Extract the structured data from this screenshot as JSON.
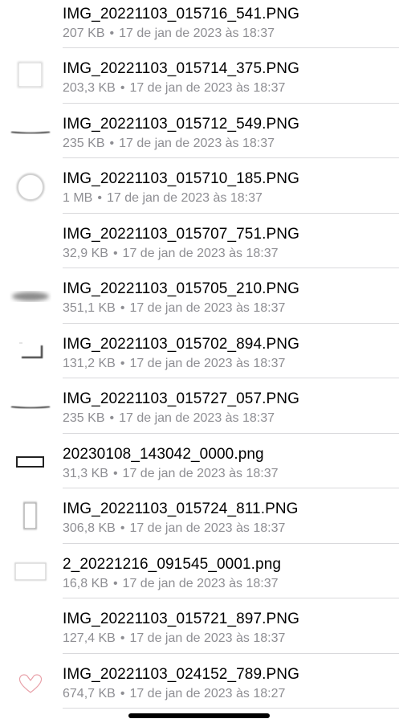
{
  "files": [
    {
      "name": "IMG_20221103_015716_541.PNG",
      "size": "207 KB",
      "date": "17 de jan de 2023 às 18:37",
      "thumbnail": "thin-line-thumbnail"
    },
    {
      "name": "IMG_20221103_015714_375.PNG",
      "size": "203,3 KB",
      "date": "17 de jan de 2023 às 18:37",
      "thumbnail": "square-thumbnail"
    },
    {
      "name": "IMG_20221103_015712_549.PNG",
      "size": "235 KB",
      "date": "17 de jan de 2023 às 18:37",
      "thumbnail": "dark-line-thumbnail"
    },
    {
      "name": "IMG_20221103_015710_185.PNG",
      "size": "1 MB",
      "date": "17 de jan de 2023 às 18:37",
      "thumbnail": "circle-thumbnail"
    },
    {
      "name": "IMG_20221103_015707_751.PNG",
      "size": "32,9 KB",
      "date": "17 de jan de 2023 às 18:37",
      "thumbnail": "thin-line-thumbnail"
    },
    {
      "name": "IMG_20221103_015705_210.PNG",
      "size": "351,1 KB",
      "date": "17 de jan de 2023 às 18:37",
      "thumbnail": "blurred-ellipse-thumbnail"
    },
    {
      "name": "IMG_20221103_015702_894.PNG",
      "size": "131,2 KB",
      "date": "17 de jan de 2023 às 18:37",
      "thumbnail": "corner-thumbnail"
    },
    {
      "name": "IMG_20221103_015727_057.PNG",
      "size": "235 KB",
      "date": "17 de jan de 2023 às 18:37",
      "thumbnail": "dark-line-thumbnail"
    },
    {
      "name": "20230108_143042_0000.png",
      "size": "31,3 KB",
      "date": "17 de jan de 2023 às 18:37",
      "thumbnail": "rectangle-outline-thumbnail"
    },
    {
      "name": "IMG_20221103_015724_811.PNG",
      "size": "306,8 KB",
      "date": "17 de jan de 2023 às 18:37",
      "thumbnail": "tall-rectangle-thumbnail"
    },
    {
      "name": "2_20221216_091545_0001.png",
      "size": "16,8 KB",
      "date": "17 de jan de 2023 às 18:37",
      "thumbnail": "wide-rectangle-thumbnail"
    },
    {
      "name": "IMG_20221103_015721_897.PNG",
      "size": "127,4 KB",
      "date": "17 de jan de 2023 às 18:37",
      "thumbnail": "thin-line-thumbnail"
    },
    {
      "name": "IMG_20221103_024152_789.PNG",
      "size": "674,7 KB",
      "date": "17 de jan de 2023 às 18:27",
      "thumbnail": "heart-thumbnail"
    }
  ],
  "meta_separator": "•",
  "colors": {
    "name_text": "#000000",
    "meta_text": "#8e8e93",
    "divider": "#d9d9dc",
    "home_indicator": "#000000",
    "heart_outline": "#e8a0a8"
  }
}
